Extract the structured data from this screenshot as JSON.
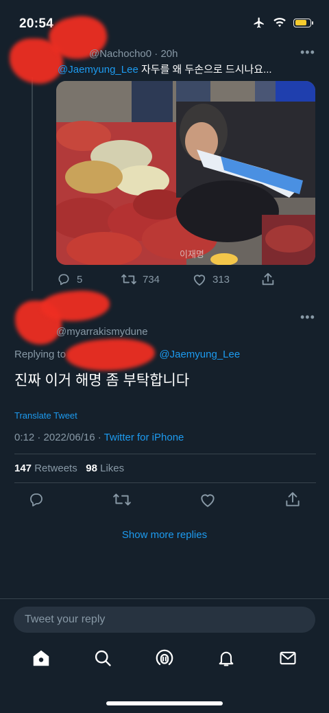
{
  "status_bar": {
    "time": "20:54"
  },
  "parent_tweet": {
    "handle_meta": "@Nachocho0 · 20h",
    "mention": "@Jaemyung_Lee",
    "text": " 자두를 왜 두손으로 드시나요...",
    "image_caption": "이재명",
    "reply_count": "5",
    "retweet_count": "734",
    "like_count": "313"
  },
  "main_tweet": {
    "handle": "@myarrakismydune",
    "replying_prefix": "Replying to",
    "replying_mention": "@Jaemyung_Lee",
    "text": "진짜 이거 해명 좀 부탁합니다",
    "translate_label": "Translate Tweet",
    "timestamp": "0:12 · 2022/06/16 · ",
    "source": "Twitter for iPhone",
    "retweets_value": "147",
    "retweets_label": " Retweets",
    "likes_value": "98",
    "likes_label": " Likes"
  },
  "show_more_replies": "Show more replies",
  "reply_box": {
    "placeholder": "Tweet your reply"
  },
  "tab_bar": {
    "icons": [
      "home-icon",
      "search-icon",
      "spaces-icon",
      "notifications-icon",
      "messages-icon"
    ]
  },
  "colors": {
    "background": "#15202b",
    "accent": "#1d9bf0",
    "muted": "#8899a6",
    "divider": "#38444d",
    "redaction": "#ee2e22"
  }
}
